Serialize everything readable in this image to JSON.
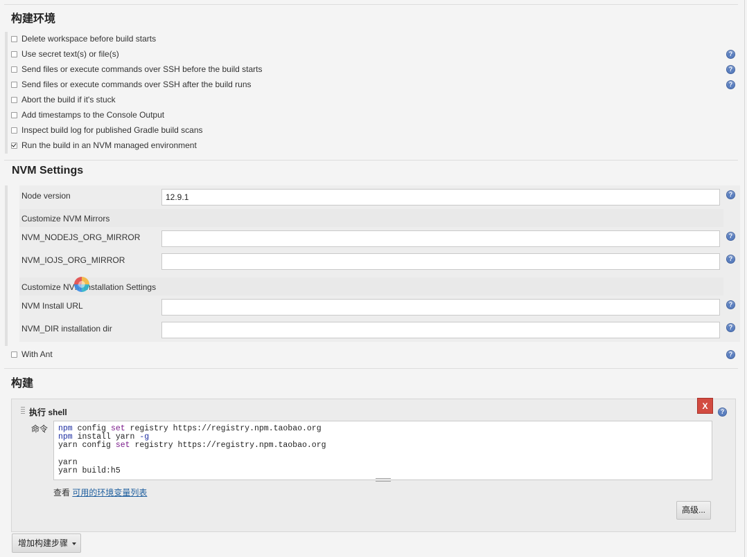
{
  "build_env": {
    "title": "构建环境",
    "options": [
      {
        "label": "Delete workspace before build starts",
        "checked": false,
        "help": false
      },
      {
        "label": "Use secret text(s) or file(s)",
        "checked": false,
        "help": true
      },
      {
        "label": "Send files or execute commands over SSH before the build starts",
        "checked": false,
        "help": true
      },
      {
        "label": "Send files or execute commands over SSH after the build runs",
        "checked": false,
        "help": true
      },
      {
        "label": "Abort the build if it's stuck",
        "checked": false,
        "help": false
      },
      {
        "label": "Add timestamps to the Console Output",
        "checked": false,
        "help": false
      },
      {
        "label": "Inspect build log for published Gradle build scans",
        "checked": false,
        "help": false
      },
      {
        "label": "Run the build in an NVM managed environment",
        "checked": true,
        "help": false
      }
    ]
  },
  "nvm": {
    "title": "NVM Settings",
    "node_version_label": "Node version",
    "node_version_value": "12.9.1",
    "mirrors_title": "Customize NVM Mirrors",
    "nodejs_mirror_label": "NVM_NODEJS_ORG_MIRROR",
    "nodejs_mirror_value": "",
    "iojs_mirror_label": "NVM_IOJS_ORG_MIRROR",
    "iojs_mirror_value": "",
    "install_title": "Customize NVM Installation Settings",
    "install_url_label": "NVM Install URL",
    "install_url_value": "",
    "dir_label": "NVM_DIR installation dir",
    "dir_value": ""
  },
  "with_ant": {
    "label": "With Ant",
    "checked": false
  },
  "build": {
    "title": "构建",
    "step_title": "执行 shell",
    "delete_label": "X",
    "command_label": "命令",
    "command_lines": [
      "npm config set registry https://registry.npm.taobao.org",
      "npm install yarn -g",
      "yarn config set registry https://registry.npm.taobao.org",
      "",
      "yarn",
      "yarn build:h5"
    ],
    "env_prefix": "查看 ",
    "env_link": "可用的环境变量列表",
    "advanced_label": "高级...",
    "add_step_label": "增加构建步骤"
  },
  "help_glyph": "?",
  "colors": {
    "help_icon": "#5b7fbf",
    "delete_button": "#d24b41",
    "link": "#1f5f9e"
  }
}
